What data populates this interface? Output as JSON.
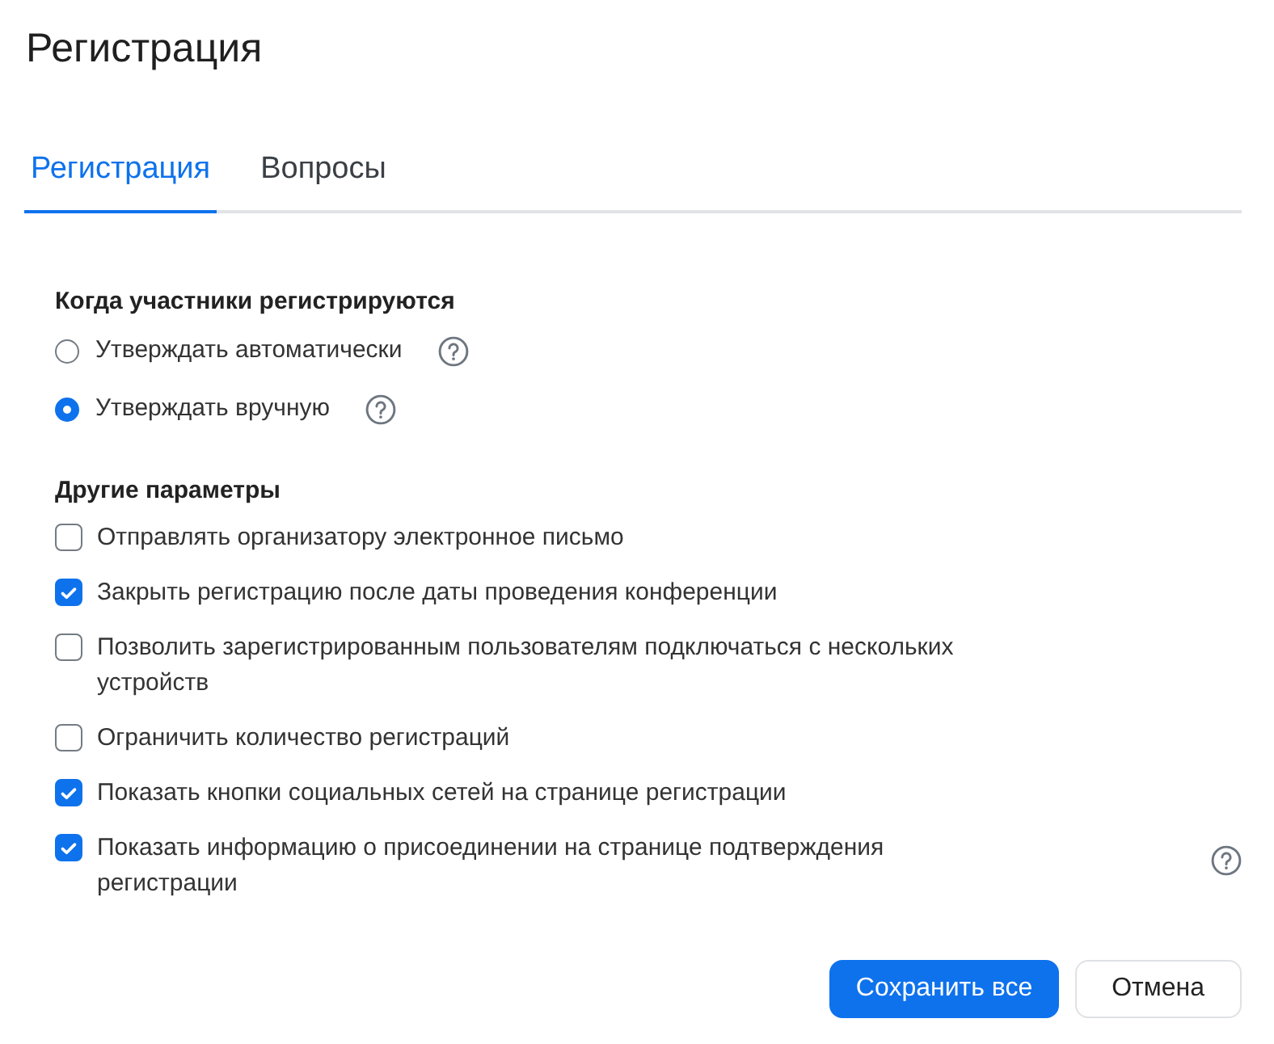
{
  "window": {
    "title": "Регистрация"
  },
  "tabs": [
    {
      "label": "Регистрация",
      "selected": true
    },
    {
      "label": "Вопросы",
      "selected": false
    }
  ],
  "approval": {
    "heading": "Когда участники регистрируются",
    "options": [
      {
        "label": "Утверждать автоматически",
        "selected": false,
        "help": true
      },
      {
        "label": "Утверждать вручную",
        "selected": true,
        "help": true
      }
    ]
  },
  "other": {
    "heading": "Другие параметры",
    "options": [
      {
        "label": "Отправлять организатору электронное письмо",
        "checked": false,
        "help": false
      },
      {
        "label": "Закрыть регистрацию после даты проведения конференции",
        "checked": true,
        "help": false
      },
      {
        "label": "Позволить зарегистрированным пользователям подключаться с нескольких устройств",
        "checked": false,
        "help": false
      },
      {
        "label": "Ограничить количество регистраций",
        "checked": false,
        "help": false
      },
      {
        "label": "Показать кнопки социальных сетей на странице регистрации",
        "checked": true,
        "help": false
      },
      {
        "label": "Показать информацию о присоединении на странице подтверждения регистрации",
        "checked": true,
        "help": true
      }
    ]
  },
  "buttons": [
    {
      "label": "Сохранить все",
      "kind": "primary"
    },
    {
      "label": "Отмена",
      "kind": "secondary"
    }
  ]
}
